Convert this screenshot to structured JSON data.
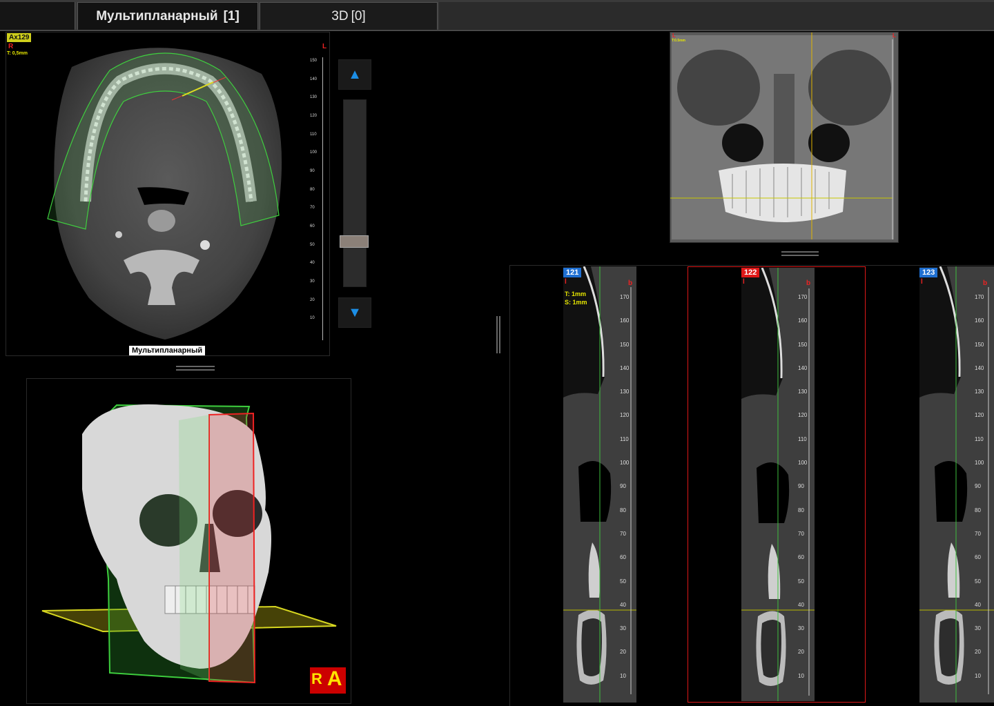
{
  "tabs": [
    {
      "label": "Мультипланарный",
      "count": "[1]",
      "active": true
    },
    {
      "label": "3D",
      "count": "[0]",
      "active": false
    }
  ],
  "axial": {
    "slice_label": "Ax129",
    "orientation_left": "R",
    "orientation_right": "L",
    "thickness": "T: 0,5mm",
    "caption": "Мультипланарный",
    "ruler_ticks": [
      "150",
      "140",
      "130",
      "120",
      "110",
      "100",
      "90",
      "80",
      "70",
      "60",
      "50",
      "40",
      "30",
      "20",
      "10"
    ]
  },
  "slider": {
    "up_label": "▲",
    "down_label": "▼",
    "position_fraction": 0.78
  },
  "coronal": {
    "corner_left": "L",
    "corner_right": "L",
    "small_label": "T:0.5mm"
  },
  "cross_sections": [
    {
      "number": "121",
      "badge_color": "#1f6fd1",
      "left_mark": "l",
      "right_mark": "b",
      "thickness": "T: 1mm",
      "spacing": "S: 1mm",
      "selected": false
    },
    {
      "number": "122",
      "badge_color": "#e01818",
      "left_mark": "l",
      "right_mark": "b",
      "thickness": "",
      "spacing": "",
      "selected": true
    },
    {
      "number": "123",
      "badge_color": "#1f6fd1",
      "left_mark": "l",
      "right_mark": "b",
      "thickness": "",
      "spacing": "",
      "selected": false
    }
  ],
  "cross_ruler_ticks": [
    "170",
    "160",
    "150",
    "140",
    "130",
    "120",
    "110",
    "100",
    "90",
    "80",
    "70",
    "60",
    "50",
    "40",
    "30",
    "20",
    "10"
  ],
  "volume": {
    "orientation_cube_left": "R",
    "orientation_cube_right": "A"
  }
}
